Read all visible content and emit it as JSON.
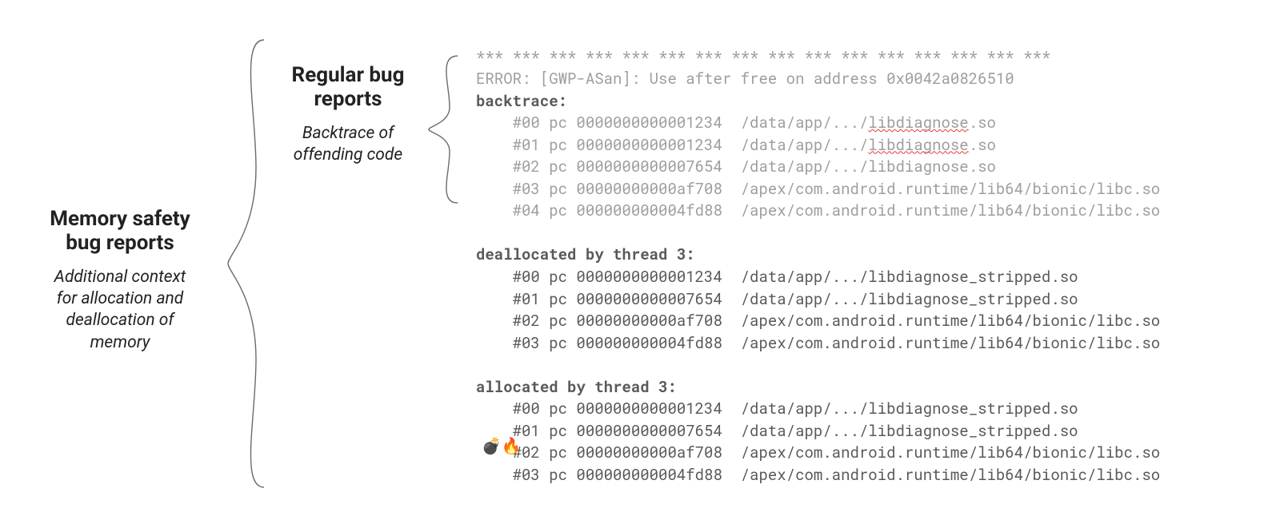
{
  "left": {
    "title1": "Memory safety",
    "title2": "bug reports",
    "sub1": "Additional context",
    "sub2": "for allocation and",
    "sub3": "deallocation of",
    "sub4": "memory"
  },
  "mid": {
    "title1": "Regular bug",
    "title2": "reports",
    "sub1": "Backtrace of",
    "sub2": "offending code"
  },
  "code": {
    "stars": "*** *** *** *** *** *** *** *** *** *** *** *** *** *** *** ***",
    "error": "ERROR: [GWP-ASan]: Use after free on address 0x0042a0826510",
    "backtrace_hdr": "backtrace:",
    "bt": [
      {
        "pre": "    #00 pc 0000000000001234  /data/app/.../",
        "sq": "libdiagnose",
        "post": ".so"
      },
      {
        "pre": "    #01 pc 0000000000001234  /data/app/.../",
        "sq": "libdiagnose",
        "post": ".so"
      },
      {
        "plain": "    #02 pc 0000000000007654  /data/app/.../libdiagnose.so"
      },
      {
        "plain": "    #03 pc 00000000000af708  /apex/com.android.runtime/lib64/bionic/libc.so"
      },
      {
        "plain": "    #04 pc 000000000004fd88  /apex/com.android.runtime/lib64/bionic/libc.so"
      }
    ],
    "dealloc_hdr": "deallocated by thread 3:",
    "dealloc": [
      "    #00 pc 0000000000001234  /data/app/.../libdiagnose_stripped.so",
      "    #01 pc 0000000000007654  /data/app/.../libdiagnose_stripped.so",
      "    #02 pc 00000000000af708  /apex/com.android.runtime/lib64/bionic/libc.so",
      "    #03 pc 000000000004fd88  /apex/com.android.runtime/lib64/bionic/libc.so"
    ],
    "alloc_hdr": "allocated by thread 3:",
    "alloc": [
      "    #00 pc 0000000000001234  /data/app/.../libdiagnose_stripped.so",
      "    #01 pc 0000000000007654  /data/app/.../libdiagnose_stripped.so",
      "    #02 pc 00000000000af708  /apex/com.android.runtime/lib64/bionic/libc.so",
      "    #03 pc 000000000004fd88  /apex/com.android.runtime/lib64/bionic/libc.so"
    ],
    "emoji": "💣🔥"
  }
}
